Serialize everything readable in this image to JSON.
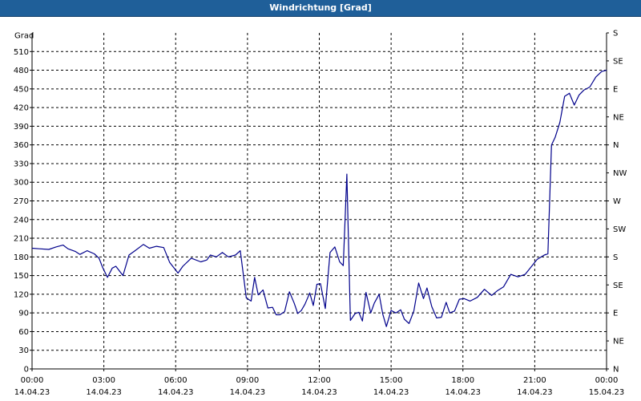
{
  "window": {
    "title": "Windrichtung [Grad]"
  },
  "chart_data": {
    "type": "line",
    "title": "Windrichtung [Grad]",
    "ylabel": "Grad",
    "ylim": [
      0,
      540
    ],
    "yticks": [
      0,
      30,
      60,
      90,
      120,
      150,
      180,
      210,
      240,
      270,
      300,
      330,
      360,
      390,
      420,
      450,
      480,
      510
    ],
    "right_axis": {
      "ticks": [
        0,
        45,
        90,
        135,
        180,
        225,
        270,
        315,
        360,
        405,
        450,
        495,
        540
      ],
      "labels": [
        "N",
        "NE",
        "E",
        "SE",
        "S",
        "SW",
        "W",
        "NW",
        "N",
        "NE",
        "E",
        "SE",
        "S"
      ]
    },
    "xlim": [
      0,
      24
    ],
    "x_tick_hours": [
      0,
      3,
      6,
      9,
      12,
      15,
      18,
      21,
      24
    ],
    "x_tick_times": [
      "00:00",
      "03:00",
      "06:00",
      "09:00",
      "12:00",
      "15:00",
      "18:00",
      "21:00",
      "00:00"
    ],
    "x_tick_dates": [
      "14.04.23",
      "14.04.23",
      "14.04.23",
      "14.04.23",
      "14.04.23",
      "14.04.23",
      "14.04.23",
      "14.04.23",
      "15.04.23"
    ],
    "grid": true,
    "line_color": "#00008b",
    "series": [
      {
        "x": [
          0,
          0.3,
          0.7,
          1.0,
          1.3,
          1.5,
          1.8,
          2.0,
          2.3,
          2.6,
          2.8,
          2.95,
          3.15,
          3.35,
          3.5,
          3.8,
          4.05,
          4.3,
          4.65,
          4.9,
          5.2,
          5.5,
          5.75,
          6.1,
          6.3,
          6.65,
          7.05,
          7.3,
          7.45,
          7.7,
          7.95,
          8.2,
          8.5,
          8.7,
          8.95,
          9.15,
          9.3,
          9.45,
          9.65,
          9.85,
          10.05,
          10.2,
          10.35,
          10.55,
          10.75,
          10.95,
          11.1,
          11.25,
          11.4,
          11.6,
          11.75,
          11.9,
          12.05,
          12.25,
          12.45,
          12.65,
          12.85,
          13.0,
          13.15,
          13.3,
          13.5,
          13.65,
          13.8,
          13.95,
          14.15,
          14.3,
          14.5,
          14.65,
          14.8,
          15.0,
          15.2,
          15.4,
          15.55,
          15.75,
          15.95,
          16.15,
          16.35,
          16.5,
          16.7,
          16.9,
          17.1,
          17.3,
          17.45,
          17.65,
          17.85,
          18.05,
          18.3,
          18.6,
          18.9,
          19.2,
          19.45,
          19.7,
          20.0,
          20.3,
          20.6,
          20.85,
          21.1,
          21.4,
          21.55,
          21.7,
          21.85,
          22.05,
          22.25,
          22.45,
          22.65,
          22.85,
          23.05,
          23.3,
          23.55,
          23.8,
          24.0
        ],
        "y": [
          194,
          193,
          192,
          196,
          199,
          193,
          189,
          184,
          190,
          185,
          178,
          163,
          147,
          162,
          165,
          150,
          183,
          190,
          200,
          194,
          197,
          195,
          171,
          154,
          165,
          178,
          172,
          175,
          183,
          180,
          187,
          180,
          183,
          190,
          114,
          109,
          147,
          119,
          127,
          98,
          99,
          87,
          87,
          92,
          124,
          106,
          89,
          94,
          104,
          122,
          102,
          136,
          137,
          97,
          187,
          196,
          172,
          166,
          313,
          78,
          89,
          91,
          77,
          123,
          90,
          106,
          120,
          88,
          68,
          94,
          90,
          95,
          80,
          73,
          93,
          138,
          113,
          130,
          100,
          82,
          83,
          107,
          90,
          93,
          112,
          113,
          109,
          115,
          128,
          118,
          126,
          132,
          152,
          148,
          152,
          164,
          176,
          183,
          185,
          360,
          372,
          396,
          438,
          443,
          424,
          440,
          448,
          453,
          469,
          478,
          480
        ]
      }
    ]
  }
}
